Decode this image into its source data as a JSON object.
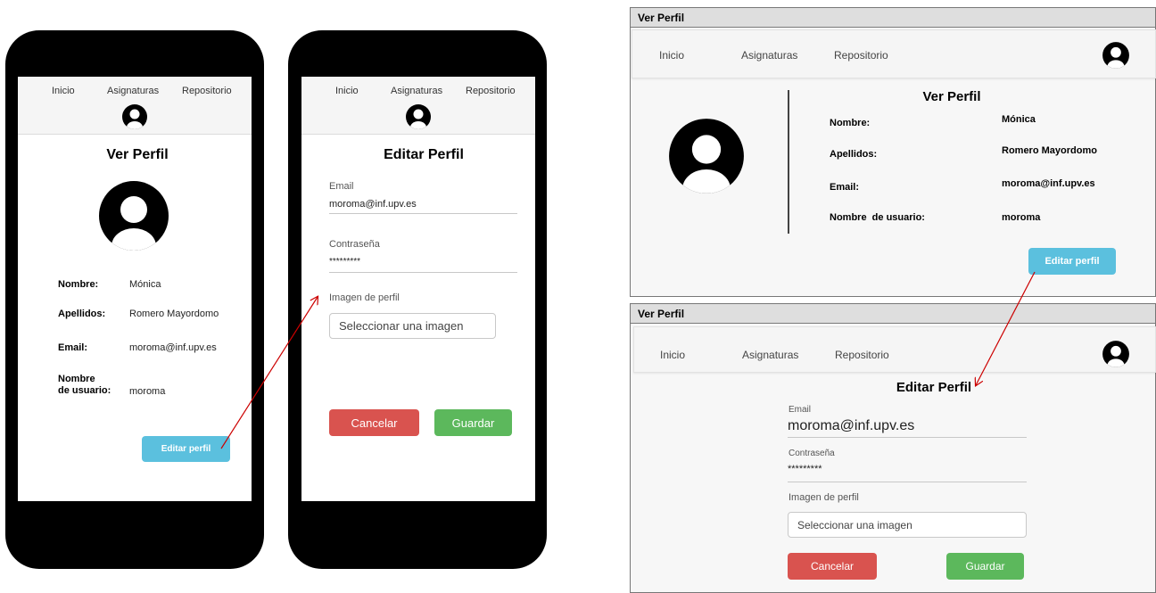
{
  "mobile_view": {
    "nav": {
      "inicio": "Inicio",
      "asignaturas": "Asignaturas",
      "repositorio": "Repositorio"
    },
    "title": "Ver Perfil",
    "fields": [
      {
        "label": "Nombre:",
        "value": "Mónica"
      },
      {
        "label": "Apellidos:",
        "value": "Romero Mayordomo"
      },
      {
        "label": "Email:",
        "value": "moroma@inf.upv.es"
      },
      {
        "label_line1": "Nombre",
        "label_line2": "de usuario:",
        "value": "moroma"
      }
    ],
    "edit_button": "Editar perfil"
  },
  "mobile_edit": {
    "nav": {
      "inicio": "Inicio",
      "asignaturas": "Asignaturas",
      "repositorio": "Repositorio"
    },
    "title": "Editar Perfil",
    "email_label": "Email",
    "email_value": "moroma@inf.upv.es",
    "password_label": "Contraseña",
    "password_value": "*********",
    "image_label": "Imagen de perfil",
    "image_placeholder": "Seleccionar una imagen",
    "cancel_button": "Cancelar",
    "save_button": "Guardar"
  },
  "desktop_view": {
    "window_title": "Ver Perfil",
    "nav": {
      "inicio": "Inicio",
      "asignaturas": "Asignaturas",
      "repositorio": "Repositorio"
    },
    "title": "Ver Perfil",
    "fields": [
      {
        "label": "Nombre:",
        "value": "Mónica"
      },
      {
        "label": "Apellidos:",
        "value": "Romero Mayordomo"
      },
      {
        "label": "Email:",
        "value": "moroma@inf.upv.es"
      },
      {
        "label": "Nombre  de usuario:",
        "value": "moroma"
      }
    ],
    "edit_button": "Editar perfil"
  },
  "desktop_edit": {
    "window_title": "Ver Perfil",
    "nav": {
      "inicio": "Inicio",
      "asignaturas": "Asignaturas",
      "repositorio": "Repositorio"
    },
    "title": "Editar Perfil",
    "email_label": "Email",
    "email_value": "moroma@inf.upv.es",
    "password_label": "Contraseña",
    "password_value": "*********",
    "image_label": "Imagen de perfil",
    "image_placeholder": "Seleccionar una imagen",
    "cancel_button": "Cancelar",
    "save_button": "Guardar"
  },
  "colors": {
    "primary_button": "#5bc0de",
    "cancel_button": "#d9534f",
    "save_button": "#5cb85c",
    "arrow": "#cc0000"
  }
}
